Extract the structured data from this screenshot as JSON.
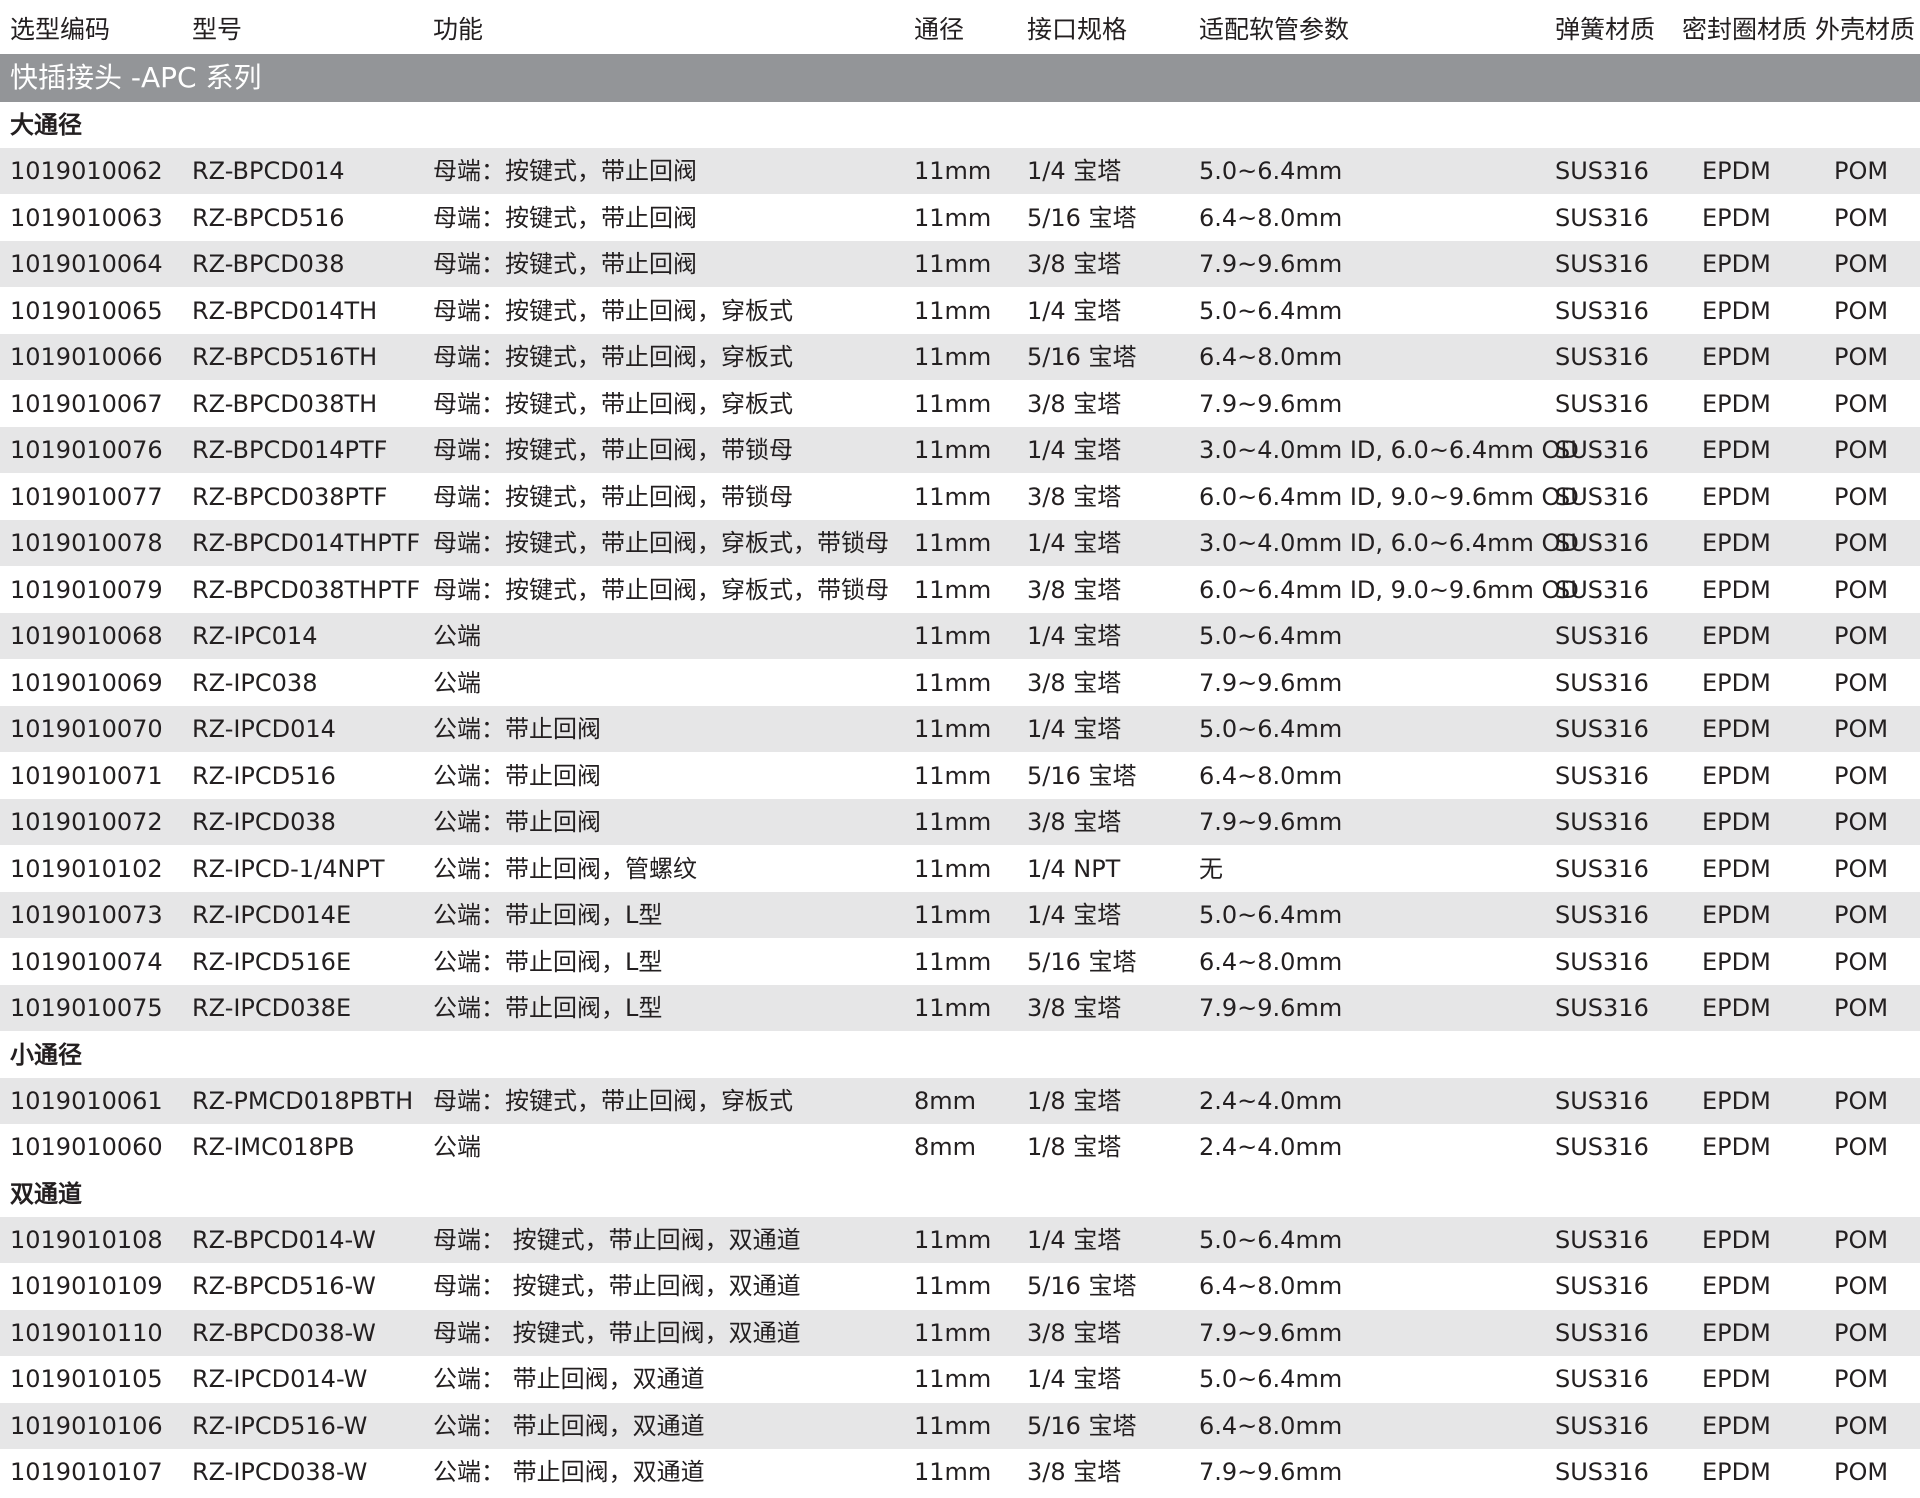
{
  "headers": [
    "选型编码",
    "型号",
    "功能",
    "通径",
    "接口规格",
    "适配软管参数",
    "弹簧材质",
    "密封圈材质",
    "外壳材质"
  ],
  "section_title": "快插接头 -APC 系列",
  "groups": [
    {
      "title": "大通径",
      "rows": [
        [
          "1019010062",
          "RZ-BPCD014",
          "母端：按键式，带止回阀",
          "11mm",
          "1/4 宝塔",
          "5.0~6.4mm",
          "SUS316",
          "EPDM",
          "POM"
        ],
        [
          "1019010063",
          "RZ-BPCD516",
          "母端：按键式，带止回阀",
          "11mm",
          "5/16 宝塔",
          "6.4~8.0mm",
          "SUS316",
          "EPDM",
          "POM"
        ],
        [
          "1019010064",
          "RZ-BPCD038",
          "母端：按键式，带止回阀",
          "11mm",
          "3/8 宝塔",
          "7.9~9.6mm",
          "SUS316",
          "EPDM",
          "POM"
        ],
        [
          "1019010065",
          "RZ-BPCD014TH",
          "母端：按键式，带止回阀，穿板式",
          "11mm",
          "1/4 宝塔",
          "5.0~6.4mm",
          "SUS316",
          "EPDM",
          "POM"
        ],
        [
          "1019010066",
          "RZ-BPCD516TH",
          "母端：按键式，带止回阀，穿板式",
          "11mm",
          "5/16 宝塔",
          "6.4~8.0mm",
          "SUS316",
          "EPDM",
          "POM"
        ],
        [
          "1019010067",
          "RZ-BPCD038TH",
          "母端：按键式，带止回阀，穿板式",
          "11mm",
          "3/8 宝塔",
          "7.9~9.6mm",
          "SUS316",
          "EPDM",
          "POM"
        ],
        [
          "1019010076",
          "RZ-BPCD014PTF",
          "母端：按键式，带止回阀，带锁母",
          "11mm",
          "1/4 宝塔",
          "3.0~4.0mm ID, 6.0~6.4mm OD",
          "SUS316",
          "EPDM",
          "POM"
        ],
        [
          "1019010077",
          "RZ-BPCD038PTF",
          "母端：按键式，带止回阀，带锁母",
          "11mm",
          "3/8 宝塔",
          "6.0~6.4mm ID, 9.0~9.6mm OD",
          "SUS316",
          "EPDM",
          "POM"
        ],
        [
          "1019010078",
          "RZ-BPCD014THPTF",
          "母端：按键式，带止回阀，穿板式，带锁母",
          "11mm",
          "1/4 宝塔",
          "3.0~4.0mm ID, 6.0~6.4mm OD",
          "SUS316",
          "EPDM",
          "POM"
        ],
        [
          "1019010079",
          "RZ-BPCD038THPTF",
          "母端：按键式，带止回阀，穿板式，带锁母",
          "11mm",
          "3/8 宝塔",
          "6.0~6.4mm ID, 9.0~9.6mm OD",
          "SUS316",
          "EPDM",
          "POM"
        ],
        [
          "1019010068",
          "RZ-IPC014",
          "公端",
          "11mm",
          "1/4 宝塔",
          "5.0~6.4mm",
          "SUS316",
          "EPDM",
          "POM"
        ],
        [
          "1019010069",
          "RZ-IPC038",
          "公端",
          "11mm",
          "3/8 宝塔",
          "7.9~9.6mm",
          "SUS316",
          "EPDM",
          "POM"
        ],
        [
          "1019010070",
          "RZ-IPCD014",
          "公端：带止回阀",
          "11mm",
          "1/4 宝塔",
          "5.0~6.4mm",
          "SUS316",
          "EPDM",
          "POM"
        ],
        [
          "1019010071",
          "RZ-IPCD516",
          "公端：带止回阀",
          "11mm",
          "5/16 宝塔",
          "6.4~8.0mm",
          "SUS316",
          "EPDM",
          "POM"
        ],
        [
          "1019010072",
          "RZ-IPCD038",
          "公端：带止回阀",
          "11mm",
          "3/8 宝塔",
          "7.9~9.6mm",
          "SUS316",
          "EPDM",
          "POM"
        ],
        [
          "1019010102",
          "RZ-IPCD-1/4NPT",
          "公端：带止回阀，管螺纹",
          "11mm",
          "1/4 NPT",
          "无",
          "SUS316",
          "EPDM",
          "POM"
        ],
        [
          "1019010073",
          "RZ-IPCD014E",
          "公端：带止回阀，L型",
          "11mm",
          "1/4 宝塔",
          "5.0~6.4mm",
          "SUS316",
          "EPDM",
          "POM"
        ],
        [
          "1019010074",
          "RZ-IPCD516E",
          "公端：带止回阀，L型",
          "11mm",
          "5/16 宝塔",
          "6.4~8.0mm",
          "SUS316",
          "EPDM",
          "POM"
        ],
        [
          "1019010075",
          "RZ-IPCD038E",
          "公端：带止回阀，L型",
          "11mm",
          "3/8 宝塔",
          "7.9~9.6mm",
          "SUS316",
          "EPDM",
          "POM"
        ]
      ]
    },
    {
      "title": "小通径",
      "rows": [
        [
          "1019010061",
          "RZ-PMCD018PBTH",
          "母端：按键式，带止回阀，穿板式",
          "8mm",
          "1/8 宝塔",
          "2.4~4.0mm",
          "SUS316",
          "EPDM",
          "POM"
        ],
        [
          "1019010060",
          "RZ-IMC018PB",
          "公端",
          "8mm",
          "1/8 宝塔",
          "2.4~4.0mm",
          "SUS316",
          "EPDM",
          "POM"
        ]
      ]
    },
    {
      "title": "双通道",
      "rows": [
        [
          "1019010108",
          "RZ-BPCD014-W",
          "母端： 按键式，带止回阀，双通道",
          "11mm",
          "1/4 宝塔",
          "5.0~6.4mm",
          "SUS316",
          "EPDM",
          "POM"
        ],
        [
          "1019010109",
          "RZ-BPCD516-W",
          "母端： 按键式，带止回阀，双通道",
          "11mm",
          "5/16 宝塔",
          "6.4~8.0mm",
          "SUS316",
          "EPDM",
          "POM"
        ],
        [
          "1019010110",
          "RZ-BPCD038-W",
          "母端： 按键式，带止回阀，双通道",
          "11mm",
          "3/8 宝塔",
          "7.9~9.6mm",
          "SUS316",
          "EPDM",
          "POM"
        ],
        [
          "1019010105",
          "RZ-IPCD014-W",
          "公端： 带止回阀，双通道",
          "11mm",
          "1/4 宝塔",
          "5.0~6.4mm",
          "SUS316",
          "EPDM",
          "POM"
        ],
        [
          "1019010106",
          "RZ-IPCD516-W",
          "公端： 带止回阀，双通道",
          "11mm",
          "5/16 宝塔",
          "6.4~8.0mm",
          "SUS316",
          "EPDM",
          "POM"
        ],
        [
          "1019010107",
          "RZ-IPCD038-W",
          "公端： 带止回阀，双通道",
          "11mm",
          "3/8 宝塔",
          "7.9~9.6mm",
          "SUS316",
          "EPDM",
          "POM"
        ]
      ]
    }
  ]
}
